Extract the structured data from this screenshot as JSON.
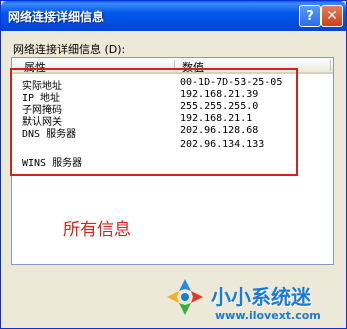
{
  "window": {
    "title": "网络连接详细信息",
    "help_glyph": "?",
    "close_glyph": "✕"
  },
  "details": {
    "group_label": "网络连接详细信息 (D):",
    "columns": [
      "属性",
      "数值"
    ],
    "rows": [
      {
        "property": "实际地址",
        "value": "00-1D-7D-53-25-05"
      },
      {
        "property": "IP 地址",
        "value": "192.168.21.39"
      },
      {
        "property": "子网掩码",
        "value": "255.255.255.0"
      },
      {
        "property": "默认网关",
        "value": "192.168.21.1"
      },
      {
        "property": "DNS 服务器",
        "value": "202.96.128.68"
      },
      {
        "property": "",
        "value": "202.96.134.133"
      },
      {
        "property": "WINS 服务器",
        "value": ""
      }
    ]
  },
  "annotation": {
    "text": "所有信息",
    "color": "#e02020"
  },
  "watermark": {
    "brand": "小小系统迷",
    "url": "www.ilovext.com"
  },
  "colors": {
    "titlebar": "#0058ee",
    "highlight": "#d42020",
    "brand": "#1a7ad6"
  }
}
